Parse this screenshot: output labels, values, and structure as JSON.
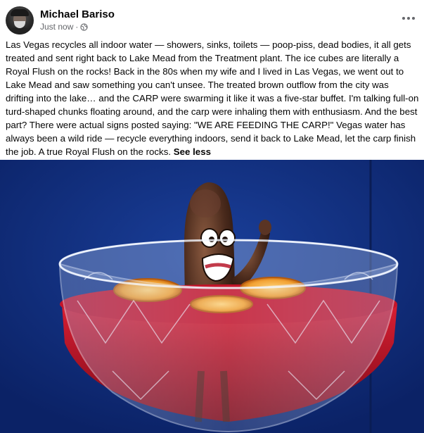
{
  "post": {
    "author": "Michael Bariso",
    "timestamp": "Just now",
    "separator": "·",
    "audience_icon": "globe-icon",
    "more_icon": "more-options-icon",
    "body": "Las Vegas recycles all indoor water — showers, sinks, toilets — poop-piss, dead bodies, it all gets treated and sent right back to Lake Mead from the Treatment plant. The ice cubes are literally a Royal Flush on the rocks! Back in the 80s when my wife and I lived in Las Vegas, we went out to Lake Mead and saw something you can't unsee. The treated brown outflow from the city was drifting into the lake… and the CARP were swarming it like it was a five-star buffet.  I'm talking full-on turd-shaped chunks floating around, and the carp were inhaling them with enthusiasm. And the best part? There were actual signs posted saying: \"WE ARE FEEDING THE CARP!\" Vegas water has always been a wild ride — recycle everything indoors, send it back to Lake Mead, let the carp finish the job. A true Royal Flush on the rocks.",
    "see_less": "See less"
  },
  "image": {
    "subject": "cartoon-character-in-punch-bowl",
    "colors": {
      "background": "#102e7a",
      "punch": "#c4142a",
      "character": "#4a2a1c",
      "orange": "#f2a233"
    }
  }
}
